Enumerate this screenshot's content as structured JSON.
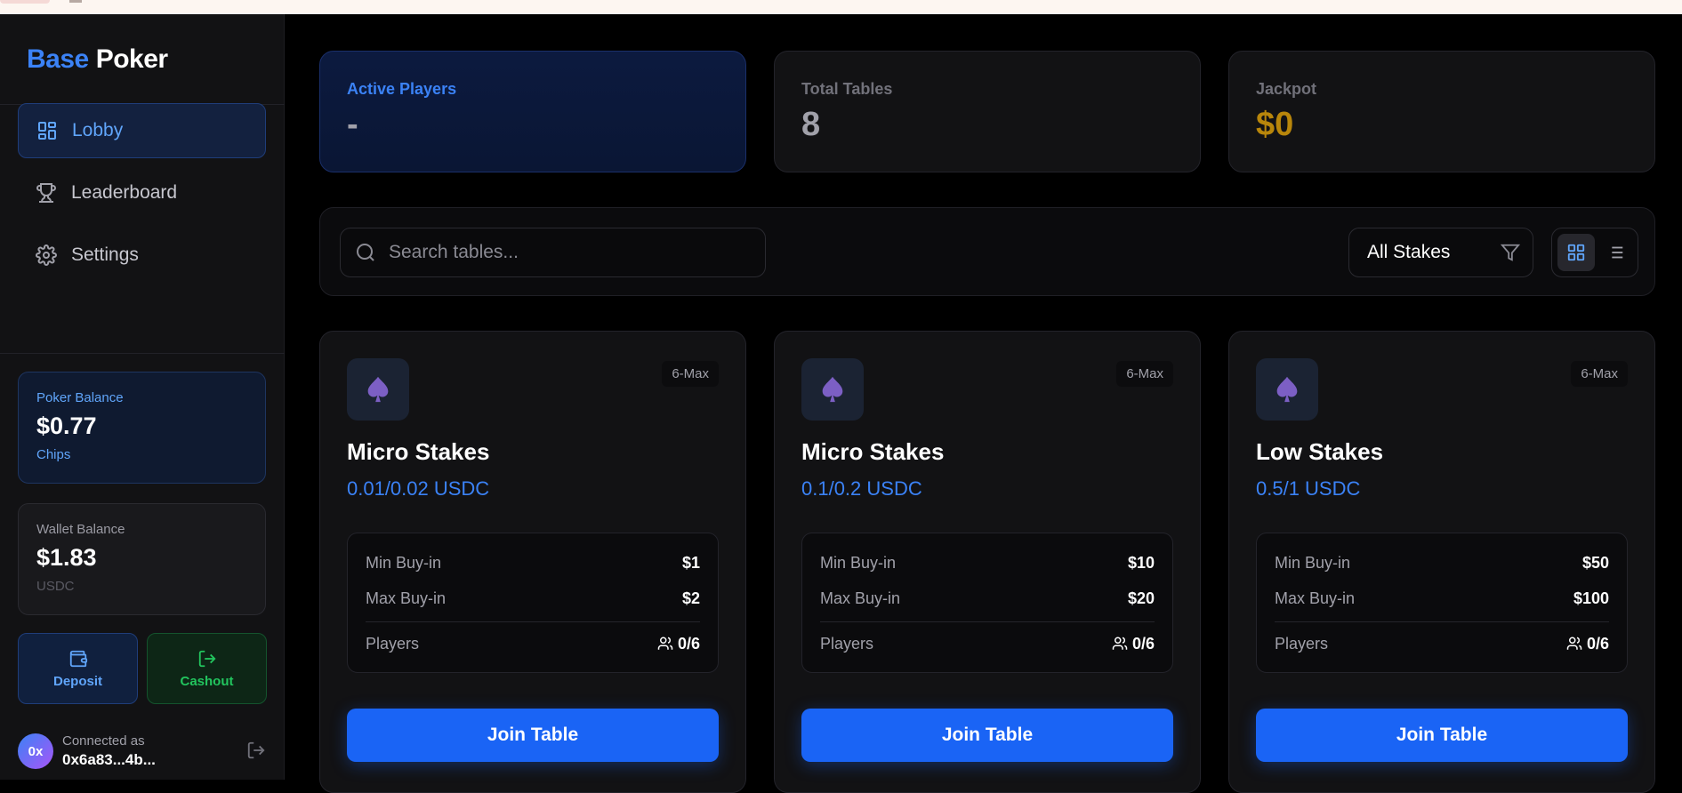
{
  "brand": {
    "part1": "Base",
    "part2": "Poker"
  },
  "nav": [
    {
      "label": "Lobby",
      "icon": "grid-icon",
      "active": true
    },
    {
      "label": "Leaderboard",
      "icon": "trophy-icon",
      "active": false
    },
    {
      "label": "Settings",
      "icon": "gear-icon",
      "active": false
    }
  ],
  "poker_balance": {
    "label": "Poker Balance",
    "value": "$0.77",
    "unit": "Chips"
  },
  "wallet_balance": {
    "label": "Wallet Balance",
    "value": "$1.83",
    "unit": "USDC"
  },
  "actions": {
    "deposit": "Deposit",
    "cashout": "Cashout"
  },
  "account": {
    "avatar": "0x",
    "label": "Connected as",
    "address": "0x6a83...4b..."
  },
  "stats": {
    "active_players": {
      "label": "Active Players",
      "value": "-"
    },
    "total_tables": {
      "label": "Total Tables",
      "value": "8"
    },
    "jackpot": {
      "label": "Jackpot",
      "value": "$0"
    }
  },
  "search": {
    "placeholder": "Search tables..."
  },
  "filter": {
    "selected": "All Stakes"
  },
  "tables": [
    {
      "badge": "6-Max",
      "name": "Micro Stakes",
      "stakes": "0.01/0.02 USDC",
      "min_label": "Min Buy-in",
      "min": "$1",
      "max_label": "Max Buy-in",
      "max": "$2",
      "players_label": "Players",
      "players": "0/6",
      "join": "Join Table"
    },
    {
      "badge": "6-Max",
      "name": "Micro Stakes",
      "stakes": "0.1/0.2 USDC",
      "min_label": "Min Buy-in",
      "min": "$10",
      "max_label": "Max Buy-in",
      "max": "$20",
      "players_label": "Players",
      "players": "0/6",
      "join": "Join Table"
    },
    {
      "badge": "6-Max",
      "name": "Low Stakes",
      "stakes": "0.5/1 USDC",
      "min_label": "Min Buy-in",
      "min": "$50",
      "max_label": "Max Buy-in",
      "max": "$100",
      "players_label": "Players",
      "players": "0/6",
      "join": "Join Table"
    }
  ],
  "colors": {
    "accent": "#3b82f6",
    "join": "#1a64f5",
    "cashout": "#22c55e",
    "jackpot": "#b8860b",
    "spade": "#7c5fc4"
  }
}
